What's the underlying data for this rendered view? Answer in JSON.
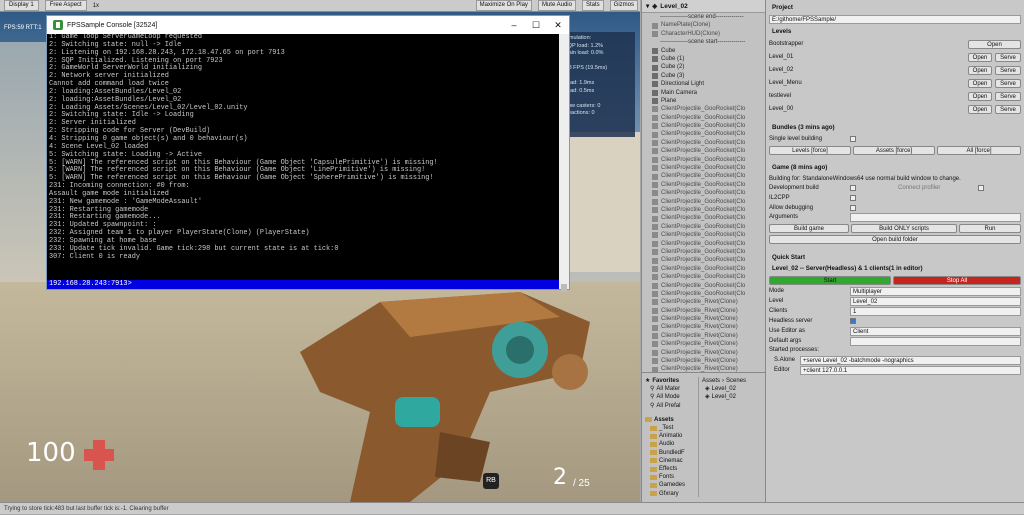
{
  "game_toolbar": {
    "display": "Display 1",
    "aspect": "Free Aspect",
    "scale": "1x",
    "buttons": [
      "Maximize On Play",
      "Mute Audio",
      "Stats",
      "Gizmos"
    ]
  },
  "fps_overlay": "FPS:59   RTT:1",
  "stats_overlay": [
    "Simulation:",
    "SQP load: 1.2%",
    "Main load: 0.0%",
    "",
    "0.8 FPS (19.5ms)",
    "",
    "Load: 1.9ms",
    "Load: 0.5ms",
    "",
    "Now casters: 0",
    "Reactions: 0"
  ],
  "hud": {
    "health": "100",
    "ammo": "2",
    "ammo_total": "/ 25",
    "rb_label": "RB"
  },
  "console": {
    "title": "FPSSample Console [32524]",
    "lines": [
      "1: Game loop ServerGameLoop requested",
      "2: Switching state: null -> Idle",
      "2: Listening on 192.168.28.243, 172.18.47.65 on port 7913",
      "2: SQP Initialized. Listening on port 7923",
      "2: GameWorld ServerWorld initializing",
      "2: Network server initialized",
      "Cannot add command load twice",
      "2: loading:AssetBundles/Level_02",
      "2: loading:AssetBundles/Level_02",
      "2: Loading Assets/Scenes/Level_02/Level_02.unity",
      "2: Switching state: Idle -> Loading",
      "2: Server initialized",
      "2: Stripping code for Server (DevBuild)",
      "4: Stripping 0 game object(s) and 0 behaviour(s)",
      "4: Scene Level_02 loaded",
      "5: Switching state: Loading -> Active",
      "5: [WARN] The referenced script on this Behaviour (Game Object 'CapsulePrimitive') is missing!",
      "5: [WARN] The referenced script on this Behaviour (Game Object 'LinePrimitive') is missing!",
      "5: [WARN] The referenced script on this Behaviour (Game Object 'SpherePrimitive') is missing!",
      "231: Incoming connection: #0 from:",
      "Assault game mode initialized",
      "231: New gamemode : 'GameModeAssault'",
      "231: Restarting gamemode",
      "231: Restarting gamemode...",
      "231: Updated spawnpoint: :",
      "232: Assigned team 1 to player PlayerState(Clone) (PlayerState)",
      "232: Spawning at home base",
      "233: Update tick invalid. Game tick:298 but current state is at tick:0",
      "307: Client 0 is ready"
    ],
    "prompt": "192.168.28.243:7913>"
  },
  "hierarchy": {
    "scene": "Level_02",
    "rows": [
      {
        "t": "--------------scene end--------------",
        "k": "sep"
      },
      {
        "t": "NamePlate(Clone)",
        "k": "dim"
      },
      {
        "t": "CharacterHUD(Clone)",
        "k": "dim"
      },
      {
        "t": "--------------scene start--------------",
        "k": "sep"
      },
      {
        "t": "Cube",
        "k": "obj"
      },
      {
        "t": "Cube (1)",
        "k": "obj"
      },
      {
        "t": "Cube (2)",
        "k": "obj"
      },
      {
        "t": "Cube (3)",
        "k": "obj"
      },
      {
        "t": "Directional Light",
        "k": "obj"
      },
      {
        "t": "Main Camera",
        "k": "obj"
      },
      {
        "t": "Plane",
        "k": "obj"
      },
      {
        "t": "ClientProjectile_GooRocket(Clo",
        "k": "dim"
      },
      {
        "t": "ClientProjectile_GooRocket(Clo",
        "k": "dim"
      },
      {
        "t": "ClientProjectile_GooRocket(Clo",
        "k": "dim"
      },
      {
        "t": "ClientProjectile_GooRocket(Clo",
        "k": "dim"
      },
      {
        "t": "ClientProjectile_GooRocket(Clo",
        "k": "dim"
      },
      {
        "t": "ClientProjectile_GooRocket(Clo",
        "k": "dim"
      },
      {
        "t": "ClientProjectile_GooRocket(Clo",
        "k": "dim"
      },
      {
        "t": "ClientProjectile_GooRocket(Clo",
        "k": "dim"
      },
      {
        "t": "ClientProjectile_GooRocket(Clo",
        "k": "dim"
      },
      {
        "t": "ClientProjectile_GooRocket(Clo",
        "k": "dim"
      },
      {
        "t": "ClientProjectile_GooRocket(Clo",
        "k": "dim"
      },
      {
        "t": "ClientProjectile_GooRocket(Clo",
        "k": "dim"
      },
      {
        "t": "ClientProjectile_GooRocket(Clo",
        "k": "dim"
      },
      {
        "t": "ClientProjectile_GooRocket(Clo",
        "k": "dim"
      },
      {
        "t": "ClientProjectile_GooRocket(Clo",
        "k": "dim"
      },
      {
        "t": "ClientProjectile_GooRocket(Clo",
        "k": "dim"
      },
      {
        "t": "ClientProjectile_GooRocket(Clo",
        "k": "dim"
      },
      {
        "t": "ClientProjectile_GooRocket(Clo",
        "k": "dim"
      },
      {
        "t": "ClientProjectile_GooRocket(Clo",
        "k": "dim"
      },
      {
        "t": "ClientProjectile_GooRocket(Clo",
        "k": "dim"
      },
      {
        "t": "ClientProjectile_GooRocket(Clo",
        "k": "dim"
      },
      {
        "t": "ClientProjectile_GooRocket(Clo",
        "k": "dim"
      },
      {
        "t": "ClientProjectile_GooRocket(Clo",
        "k": "dim"
      },
      {
        "t": "ClientProjectile_Rivet(Clone)",
        "k": "dim"
      },
      {
        "t": "ClientProjectile_Rivet(Clone)",
        "k": "dim"
      },
      {
        "t": "ClientProjectile_Rivet(Clone)",
        "k": "dim"
      },
      {
        "t": "ClientProjectile_Rivet(Clone)",
        "k": "dim"
      },
      {
        "t": "ClientProjectile_Rivet(Clone)",
        "k": "dim"
      },
      {
        "t": "ClientProjectile_Rivet(Clone)",
        "k": "dim"
      },
      {
        "t": "ClientProjectile_Rivet(Clone)",
        "k": "dim"
      },
      {
        "t": "ClientProjectile_Rivet(Clone)",
        "k": "dim"
      },
      {
        "t": "ClientProjectile_Rivet(Clone)",
        "k": "dim"
      }
    ]
  },
  "project": {
    "favorites_label": "Favorites",
    "favorites": [
      "All Mater",
      "All Mode",
      "All Prefal"
    ],
    "breadcrumb": [
      "Assets",
      "Scenes"
    ],
    "scene_files": [
      "Level_02",
      "Level_02"
    ],
    "assets_label": "Assets",
    "assets": [
      "_Test",
      "Animatio",
      "Audio",
      "BundledF",
      "Cinemac",
      "Effects",
      "Fonts",
      "Gamedes",
      "Gfxrary"
    ]
  },
  "inspector": {
    "project_label": "Project",
    "project_path": "E:/githome/FPSSample/",
    "levels_label": "Levels",
    "levels": [
      {
        "name": "Bootstrapper",
        "buttons": [
          "Open"
        ]
      },
      {
        "name": "Level_01",
        "buttons": [
          "Open",
          "Serve"
        ]
      },
      {
        "name": "Level_02",
        "buttons": [
          "Open",
          "Serve"
        ]
      },
      {
        "name": "Level_Menu",
        "buttons": [
          "Open",
          "Serve"
        ]
      },
      {
        "name": "testlevel",
        "buttons": [
          "Open",
          "Serve"
        ]
      },
      {
        "name": "Level_00",
        "buttons": [
          "Open",
          "Serve"
        ]
      }
    ],
    "bundles_label": "Bundles (3 mins ago)",
    "single_level_building": "Single level building",
    "bundle_buttons": [
      "Levels [force]",
      "Assets [force]",
      "All [force]"
    ],
    "game_label": "Game (8 mins ago)",
    "building_for": "Building for: StandaloneWindows64 use normal build window to change.",
    "dev_build": "Development build",
    "connect_profiler": "Connect profiler",
    "il2cpp": "IL2CPP",
    "allow_debugging": "Allow debugging",
    "arguments": "Arguments",
    "build_buttons": [
      "Build game",
      "Build ONLY scripts",
      "Run"
    ],
    "open_build_folder": "Open build folder",
    "quick_start": "Quick Start",
    "quick_start_summary": "Level_02 -- Server(Headless) & 1 clients(1 in editor)",
    "start_label": "Start",
    "stop_label": "Stop All",
    "fields": [
      {
        "label": "Mode",
        "value": "Multiplayer"
      },
      {
        "label": "Level",
        "value": "Level_02"
      },
      {
        "label": "Clients",
        "value": "1"
      },
      {
        "label": "Headless server",
        "value": ""
      },
      {
        "label": "Use Editor as",
        "value": "Client"
      },
      {
        "label": "Default args",
        "value": ""
      }
    ],
    "started_processes": "Started processes:",
    "processes": [
      {
        "name": "S.Alone",
        "args": "+serve Level_02 -batchmode -nographics"
      },
      {
        "name": "Editor",
        "args": "+client 127.0.0.1"
      }
    ],
    "colors": {
      "start": "#2faa2f",
      "stop": "#c8241f"
    }
  },
  "status_bar": "Trying to store tick:483 but last buffer tick is:-1. Clearing buffer"
}
